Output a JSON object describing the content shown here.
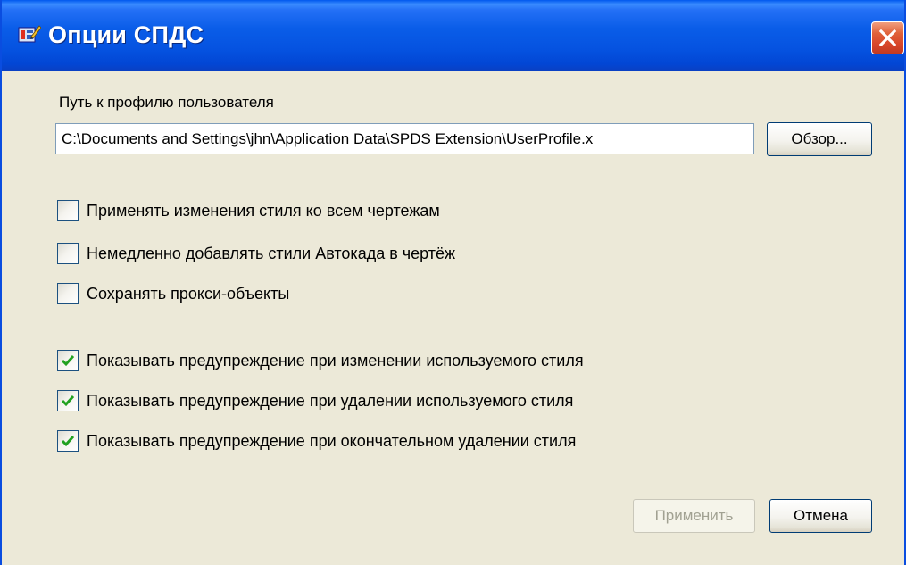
{
  "window": {
    "title": "Опции СПДС",
    "title_icon": "app-icon",
    "close_icon": "close-icon"
  },
  "profile": {
    "label": "Путь к профилю пользователя",
    "path_value": "C:\\Documents and Settings\\jhn\\Application Data\\SPDS Extension\\UserProfile.x",
    "browse_label": "Обзор..."
  },
  "options": [
    {
      "label": "Применять изменения стиля ко всем чертежам",
      "checked": false
    },
    {
      "label": "Немедленно добавлять стили Автокада в чертёж",
      "checked": false
    },
    {
      "label": "Сохранять прокси-объекты",
      "checked": false
    },
    {
      "label": "Показывать предупреждение при изменении используемого стиля",
      "checked": true
    },
    {
      "label": "Показывать предупреждение при удалении используемого стиля",
      "checked": true
    },
    {
      "label": "Показывать предупреждение при окончательном удалении стиля",
      "checked": true
    }
  ],
  "buttons": {
    "apply_label": "Применить",
    "apply_enabled": false,
    "cancel_label": "Отмена"
  },
  "colors": {
    "titlebar": "#0552e0",
    "dialog_bg": "#ece9d8",
    "check_mark": "#21a121",
    "close_button": "#d8462a"
  }
}
